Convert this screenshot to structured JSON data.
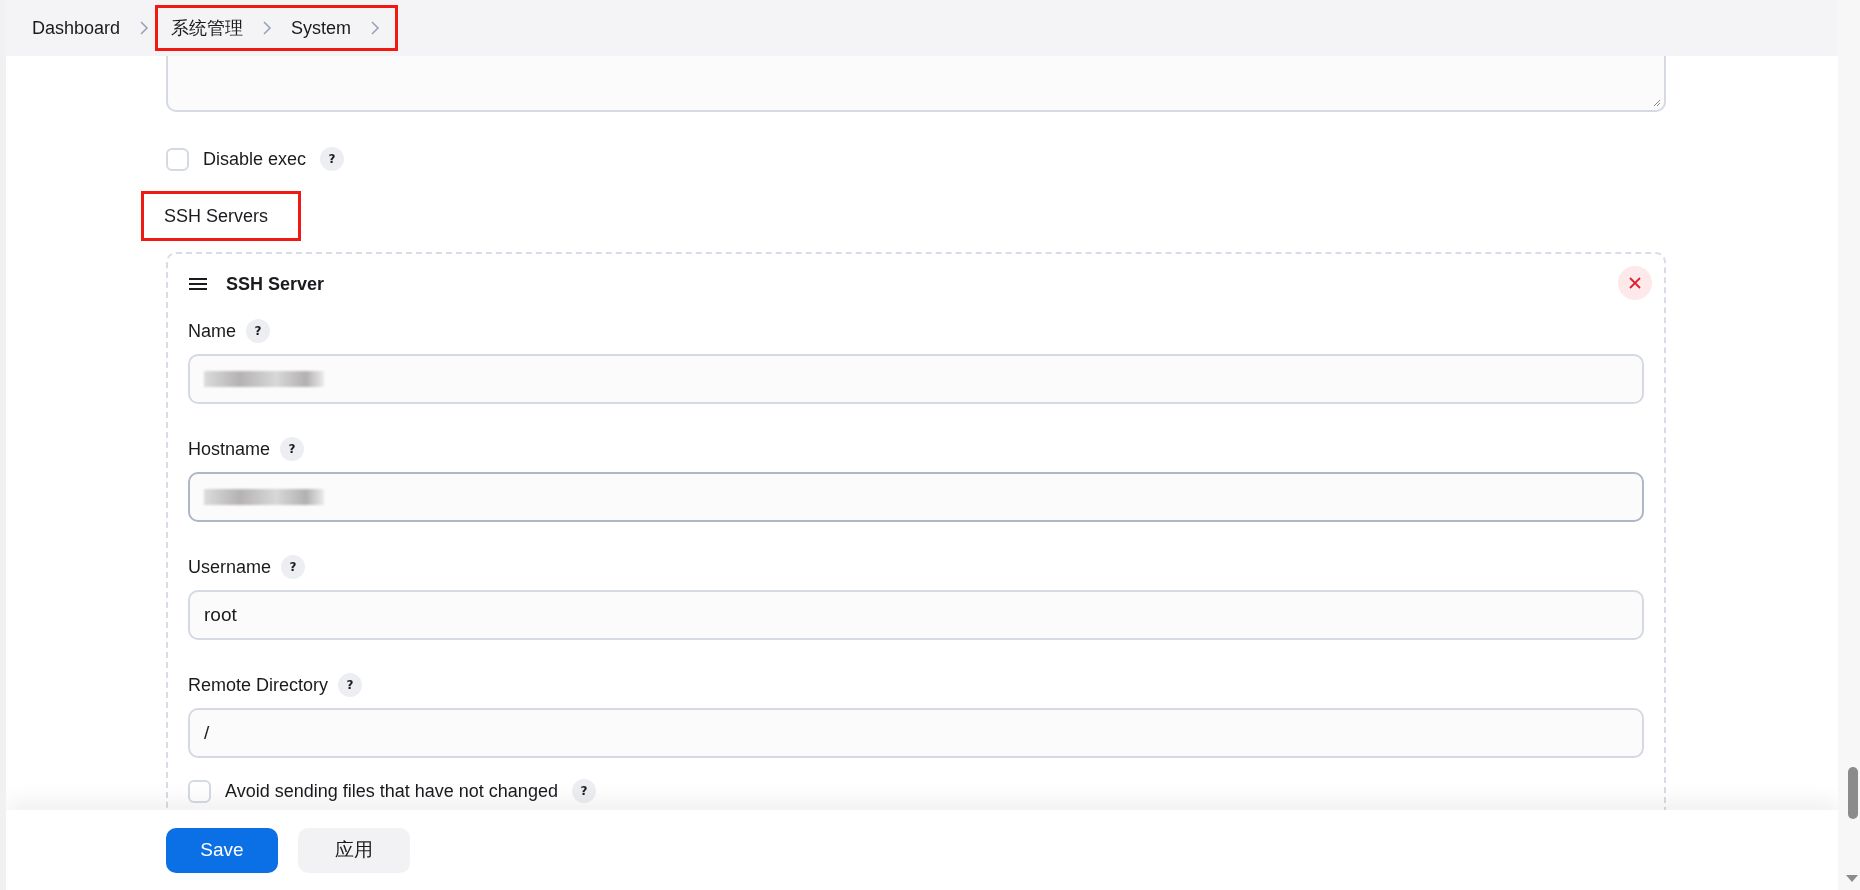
{
  "breadcrumb": [
    {
      "label": "Dashboard",
      "highlighted": false
    },
    {
      "label": "系统管理",
      "highlighted": true
    },
    {
      "label": "System",
      "highlighted": true
    }
  ],
  "disable_exec": {
    "label": "Disable exec",
    "help": "?",
    "checked": false
  },
  "section": {
    "title": "SSH Servers",
    "highlighted": true
  },
  "server": {
    "title": "SSH Server",
    "fields": [
      {
        "label": "Name",
        "help": "?",
        "redacted": true,
        "focused": false
      },
      {
        "label": "Hostname",
        "help": "?",
        "redacted": true,
        "focused": true
      },
      {
        "label": "Username",
        "help": "?",
        "value": "root",
        "redacted": false,
        "focused": false
      },
      {
        "label": "Remote Directory",
        "help": "?",
        "value": "/",
        "redacted": false,
        "focused": false
      }
    ],
    "options": [
      {
        "label": "Avoid sending files that have not changed",
        "help": "?",
        "checked": false
      }
    ]
  },
  "buttons": [
    {
      "label": "Save",
      "kind": "primary"
    },
    {
      "label": "应用",
      "kind": "secondary"
    }
  ]
}
